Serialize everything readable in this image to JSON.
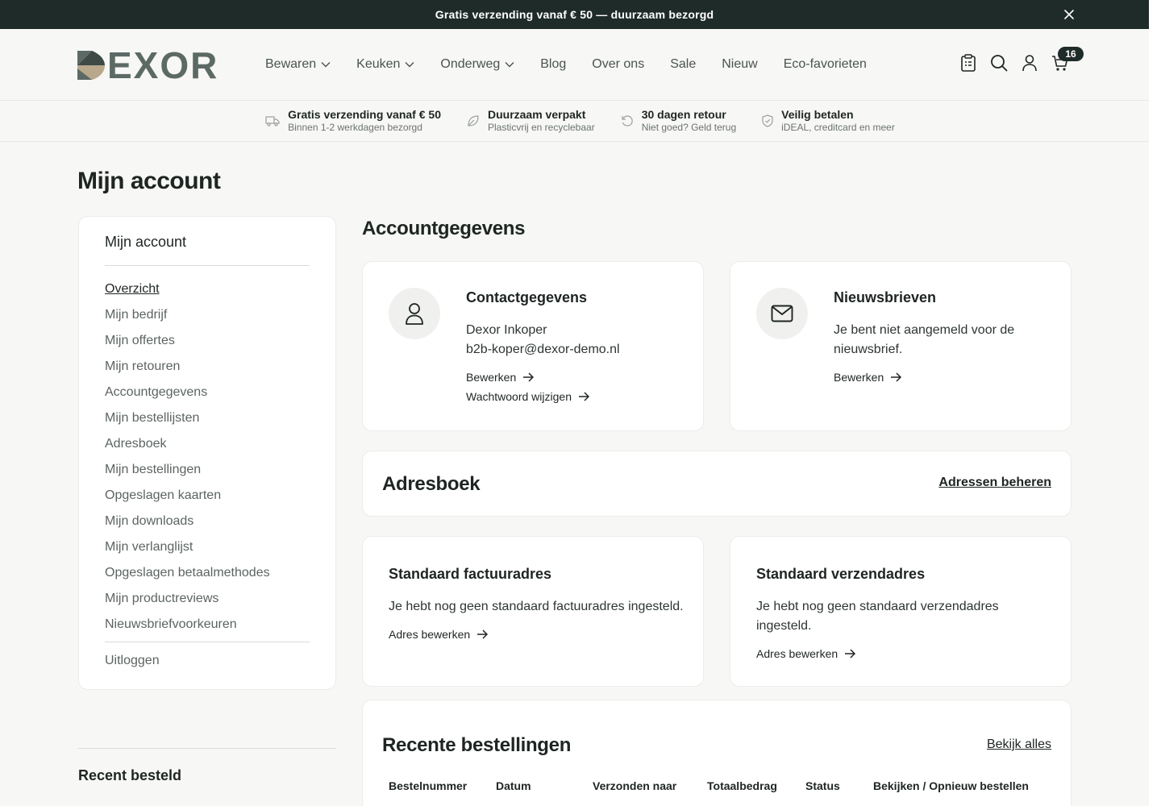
{
  "announcement": {
    "text": "Gratis verzending vanaf € 50 — duurzaam bezorgd"
  },
  "brand": {
    "logo_text": "EXOR",
    "colors": {
      "dark": "#1f2b28",
      "tan": "#b9a88c",
      "slate": "#5c6a66"
    }
  },
  "nav": {
    "items": [
      {
        "label": "Bewaren",
        "has_dropdown": true
      },
      {
        "label": "Keuken",
        "has_dropdown": true
      },
      {
        "label": "Onderweg",
        "has_dropdown": true
      },
      {
        "label": "Blog"
      },
      {
        "label": "Over ons"
      },
      {
        "label": "Sale"
      },
      {
        "label": "Nieuw"
      },
      {
        "label": "Eco-favorieten"
      }
    ]
  },
  "header": {
    "cart_count": "16",
    "icons": [
      "clipboard-icon",
      "search-icon",
      "user-icon",
      "cart-icon"
    ]
  },
  "usp": [
    {
      "icon": "truck-icon",
      "title": "Gratis verzending vanaf € 50",
      "subtitle": "Binnen 1-2 werkdagen bezorgd"
    },
    {
      "icon": "leaf-icon",
      "title": "Duurzaam verpakt",
      "subtitle": "Plasticvrij en recyclebaar"
    },
    {
      "icon": "return-icon",
      "title": "30 dagen retour",
      "subtitle": "Niet goed? Geld terug"
    },
    {
      "icon": "shield-icon",
      "title": "Veilig betalen",
      "subtitle": "iDEAL, creditcard en meer"
    }
  ],
  "page": {
    "title": "Mijn account"
  },
  "sidebar": {
    "title": "Mijn account",
    "items": [
      {
        "label": "Overzicht",
        "active": true
      },
      {
        "label": "Mijn bedrijf"
      },
      {
        "label": "Mijn offertes"
      },
      {
        "label": "Mijn retouren"
      },
      {
        "label": "Accountgegevens"
      },
      {
        "label": "Mijn bestellijsten"
      },
      {
        "label": "Adresboek"
      },
      {
        "label": "Mijn bestellingen"
      },
      {
        "label": "Opgeslagen kaarten"
      },
      {
        "label": "Mijn downloads"
      },
      {
        "label": "Mijn verlanglijst"
      },
      {
        "label": "Opgeslagen betaalmethodes"
      },
      {
        "label": "Mijn productreviews"
      },
      {
        "label": "Nieuwsbriefvoorkeuren"
      }
    ],
    "logout": "Uitloggen",
    "recent_title": "Recent besteld"
  },
  "account": {
    "section_title": "Accountgegevens",
    "contact": {
      "title": "Contactgegevens",
      "name": "Dexor Inkoper",
      "email": "b2b-koper@dexor-demo.nl",
      "edit": "Bewerken",
      "password": "Wachtwoord wijzigen"
    },
    "newsletter": {
      "title": "Nieuwsbrieven",
      "text": "Je bent niet aangemeld voor de nieuwsbrief.",
      "edit": "Bewerken"
    }
  },
  "addressbook": {
    "title": "Adresboek",
    "manage": "Adressen beheren",
    "billing": {
      "title": "Standaard factuuradres",
      "text": "Je hebt nog geen standaard factuuradres ingesteld.",
      "edit": "Adres bewerken"
    },
    "shipping": {
      "title": "Standaard verzendadres",
      "text": "Je hebt nog geen standaard verzendadres ingesteld.",
      "edit": "Adres bewerken"
    }
  },
  "orders": {
    "title": "Recente bestellingen",
    "view_all": "Bekijk alles",
    "columns": [
      "Bestelnummer",
      "Datum",
      "Verzonden naar",
      "Totaalbedrag",
      "Status",
      "Bekijken / Opnieuw bestellen"
    ]
  }
}
